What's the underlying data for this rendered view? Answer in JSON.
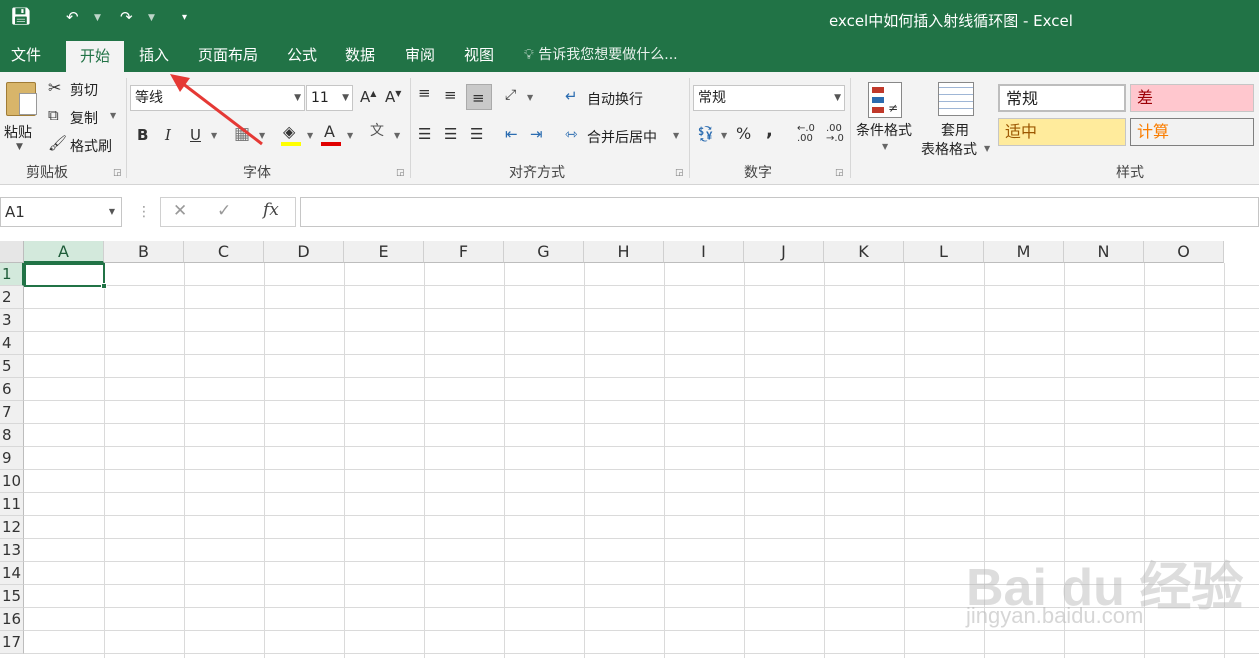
{
  "window": {
    "title": "excel中如何插入射线循环图 - Excel"
  },
  "tabs": [
    "文件",
    "开始",
    "插入",
    "页面布局",
    "公式",
    "数据",
    "审阅",
    "视图"
  ],
  "tell_me": "告诉我您想要做什么...",
  "clipboard": {
    "paste": "粘贴",
    "cut": "剪切",
    "copy": "复制",
    "format_painter": "格式刷",
    "group_label": "剪贴板"
  },
  "font": {
    "name": "等线",
    "size": "11",
    "bold": "B",
    "italic": "I",
    "underline": "U",
    "group_label": "字体"
  },
  "alignment": {
    "wrap_text": "自动换行",
    "merge_center": "合并后居中",
    "group_label": "对齐方式"
  },
  "number": {
    "format": "常规",
    "percent": "%",
    "comma": ",",
    "group_label": "数字"
  },
  "styles": {
    "conditional": "条件格式",
    "table_format_line1": "套用",
    "table_format_line2": "表格格式",
    "normal": "常规",
    "bad": "差",
    "neutral": "适中",
    "calc": "计算",
    "group_label": "样式"
  },
  "formula_bar": {
    "name_box": "A1",
    "fx": "fx",
    "value": ""
  },
  "grid": {
    "columns": [
      "A",
      "B",
      "C",
      "D",
      "E",
      "F",
      "G",
      "H",
      "I",
      "J",
      "K",
      "L",
      "M",
      "N",
      "O"
    ],
    "rows": [
      "1",
      "2",
      "3",
      "4",
      "5",
      "6",
      "7",
      "8",
      "9",
      "10",
      "11",
      "12",
      "13",
      "14",
      "15",
      "16",
      "17"
    ],
    "selected_cell": "A1"
  },
  "watermark": {
    "line1": "Bai du 经验",
    "line2": "jingyan.baidu.com"
  },
  "colors": {
    "accent": "#217346",
    "bad_bg": "#ffc7ce",
    "bad_fg": "#9c0006",
    "neutral_bg": "#ffeb9c",
    "neutral_fg": "#9c5700",
    "calc_fg": "#fa7d00",
    "arrow": "#e53935"
  }
}
